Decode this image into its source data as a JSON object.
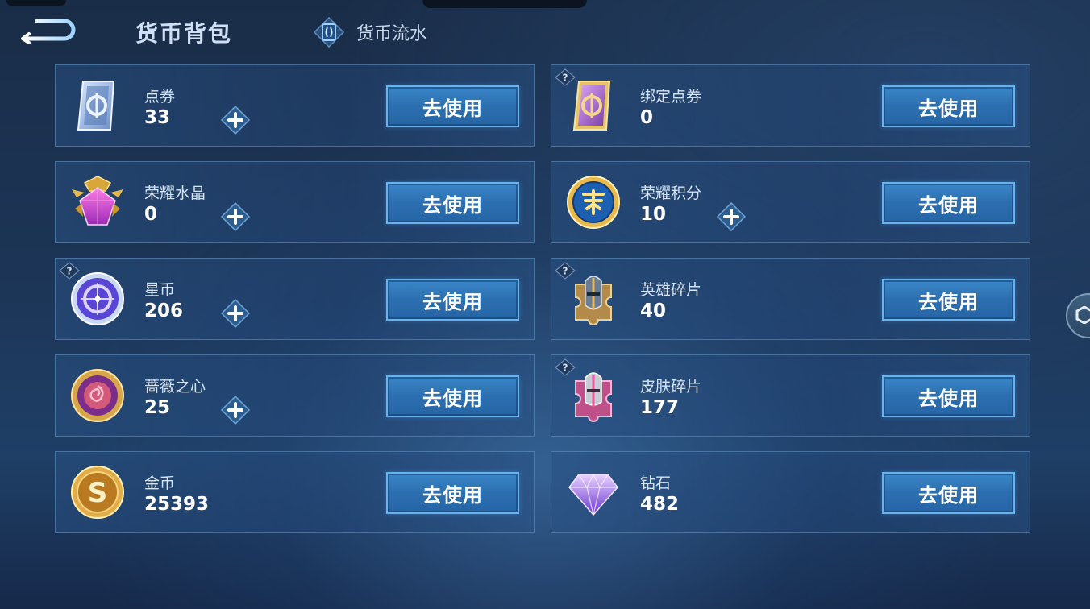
{
  "header": {
    "back_icon": "back-arrow-icon",
    "title": "货币背包",
    "flow_label": "货币流水",
    "flow_icon": "ledger-icon"
  },
  "cards": [
    {
      "name": "点券",
      "value": "33",
      "icon": "voucher-icon",
      "has_plus": true,
      "has_help": false,
      "button": "去使用"
    },
    {
      "name": "绑定点券",
      "value": "0",
      "icon": "bound-voucher-icon",
      "has_plus": false,
      "has_help": true,
      "button": "去使用"
    },
    {
      "name": "荣耀水晶",
      "value": "0",
      "icon": "glory-crystal-icon",
      "has_plus": true,
      "has_help": false,
      "button": "去使用"
    },
    {
      "name": "荣耀积分",
      "value": "10",
      "icon": "glory-points-icon",
      "has_plus": true,
      "has_help": false,
      "button": "去使用"
    },
    {
      "name": "星币",
      "value": "206",
      "icon": "star-coin-icon",
      "has_plus": true,
      "has_help": true,
      "button": "去使用"
    },
    {
      "name": "英雄碎片",
      "value": "40",
      "icon": "hero-fragment-icon",
      "has_plus": false,
      "has_help": true,
      "button": "去使用"
    },
    {
      "name": "蔷薇之心",
      "value": "25",
      "icon": "rose-heart-icon",
      "has_plus": true,
      "has_help": false,
      "button": "去使用"
    },
    {
      "name": "皮肤碎片",
      "value": "177",
      "icon": "skin-fragment-icon",
      "has_plus": false,
      "has_help": true,
      "button": "去使用"
    },
    {
      "name": "金币",
      "value": "25393",
      "icon": "gold-coin-icon",
      "has_plus": false,
      "has_help": false,
      "button": "去使用"
    },
    {
      "name": "钻石",
      "value": "482",
      "icon": "diamond-icon",
      "has_plus": false,
      "has_help": false,
      "button": "去使用"
    }
  ],
  "colors": {
    "button_fill": "#2c6fb0",
    "button_border": "#66b4ef",
    "card_border": "#78aadc",
    "background": "#1c3556"
  }
}
